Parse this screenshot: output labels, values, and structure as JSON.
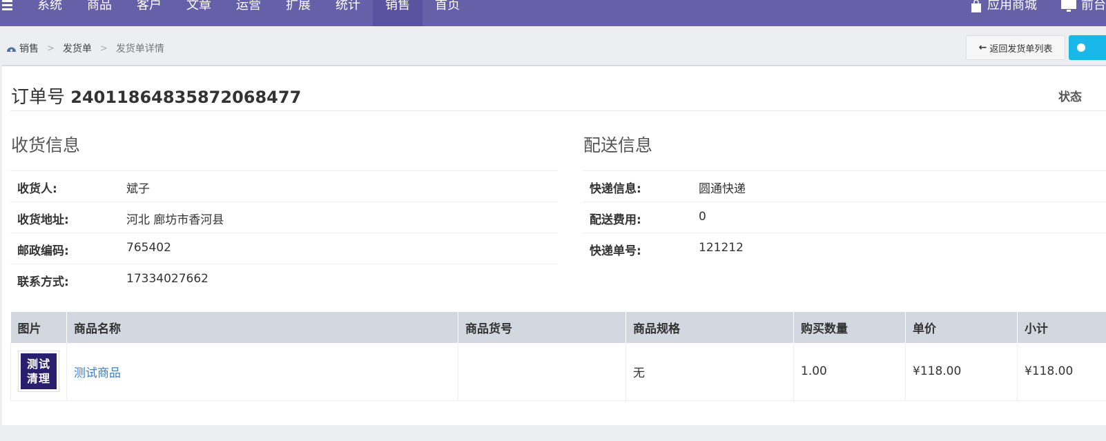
{
  "topnav": {
    "items": [
      "系统",
      "商品",
      "客户",
      "文章",
      "运营",
      "扩展",
      "统计",
      "销售",
      "首页"
    ],
    "active_index": 7,
    "right": {
      "app_store": "应用商城",
      "frontend": "前台"
    }
  },
  "breadcrumb": [
    "销售",
    "发货单",
    "发货单详情"
  ],
  "back_button": "返回发货单列表",
  "order": {
    "label": "订单号",
    "number": "24011864835872068477",
    "status_label": "状态"
  },
  "receiver": {
    "title": "收货信息",
    "rows": [
      {
        "key": "收货人:",
        "value": "斌子"
      },
      {
        "key": "收货地址:",
        "value": "河北 廊坊市香河县"
      },
      {
        "key": "邮政编码:",
        "value": "765402"
      },
      {
        "key": "联系方式:",
        "value": "17334027662"
      }
    ]
  },
  "delivery": {
    "title": "配送信息",
    "rows": [
      {
        "key": "快递信息:",
        "value": "圆通快递"
      },
      {
        "key": "配送费用:",
        "value": "0"
      },
      {
        "key": "快递单号:",
        "value": "121212"
      }
    ]
  },
  "goods": {
    "headers": [
      "图片",
      "商品名称",
      "商品货号",
      "商品规格",
      "购买数量",
      "单价",
      "小计"
    ],
    "rows": [
      {
        "image_text": "测试清理",
        "image_line1": "测试",
        "image_line2": "清理",
        "name": "测试商品",
        "sku": "",
        "spec": "无",
        "qty": "1.00",
        "price": "¥118.00",
        "subtotal": "¥118.00"
      }
    ]
  },
  "colors": {
    "nav_bg": "#6660a8",
    "accent": "#1ab7ea",
    "link": "#3c7fc3"
  }
}
